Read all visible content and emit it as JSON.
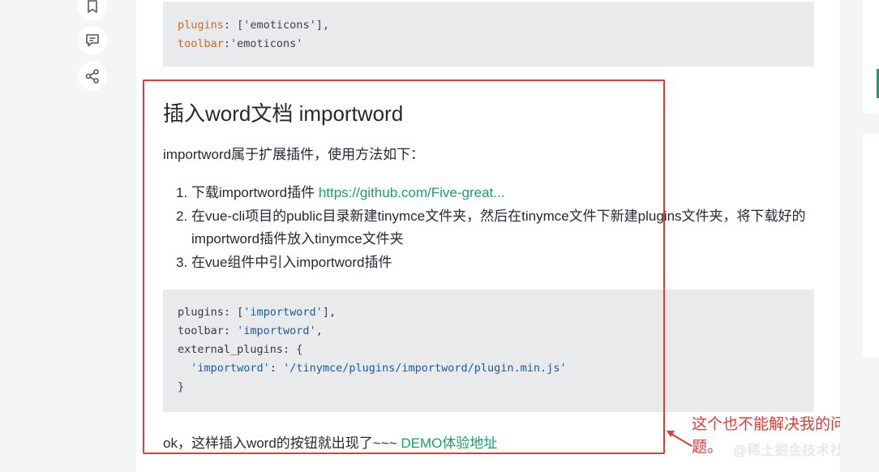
{
  "code_top": {
    "line1_key": "plugins",
    "line1_rest": ": ['emoticons'],",
    "line2_key": "toolbar",
    "line2_rest": ":'emoticons'"
  },
  "heading": "插入word文档 importword",
  "intro": "importword属于扩展插件，使用方法如下：",
  "steps": [
    {
      "num": "1.",
      "text": "下载importword插件 ",
      "link": "https://github.com/Five-great..."
    },
    {
      "num": "2.",
      "text": "在vue-cli项目的public目录新建tinymce文件夹，然后在tinymce文件下新建plugins文件夹，将下载好的importword插件放入tinymce文件夹"
    },
    {
      "num": "3.",
      "text": "在vue组件中引入importword插件"
    }
  ],
  "code_main": {
    "l1a": "plugins: [",
    "l1s": "'importword'",
    "l1b": "],",
    "l2a": "toolbar: ",
    "l2s": "'importword'",
    "l2b": ",",
    "l3": "external_plugins: {",
    "l4s1": "'importword'",
    "l4m": ": ",
    "l4s2": "'/tinymce/plugins/importword/plugin.min.js'",
    "l5": "}"
  },
  "outro": {
    "text": "ok，这样插入word的按钮就出现了~~~ ",
    "link": "DEMO体验地址"
  },
  "annotation": "这个也不能解决我的问题。",
  "watermark": "@稀土掘金技术社区",
  "colors": {
    "annotation": "#e53935",
    "link_blue": "#1e80ff",
    "link_green": "#1a9e6e",
    "code_bg": "#e9eaec"
  },
  "icons": [
    "bookmark-icon",
    "comment-icon",
    "share-icon"
  ]
}
